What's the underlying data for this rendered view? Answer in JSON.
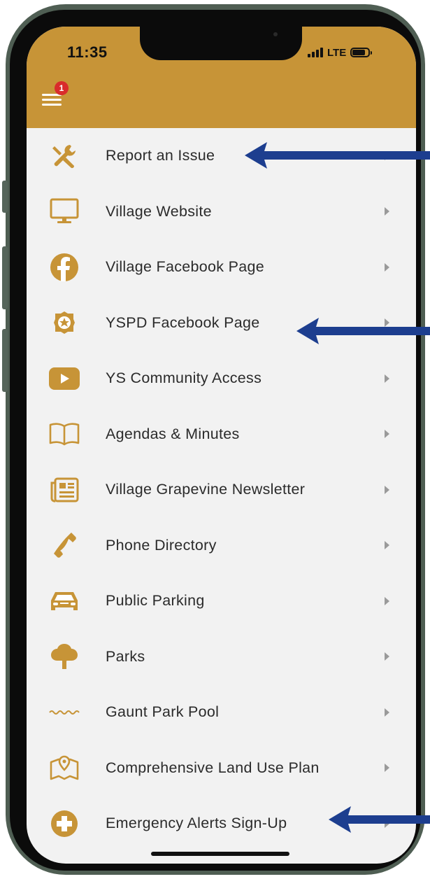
{
  "status_bar": {
    "time": "11:35",
    "network": "LTE"
  },
  "header": {
    "notification_count": "1"
  },
  "menu": {
    "items": [
      {
        "label": "Report an Issue",
        "icon": "tools-icon"
      },
      {
        "label": "Village Website",
        "icon": "monitor-icon"
      },
      {
        "label": "Village Facebook Page",
        "icon": "facebook-icon"
      },
      {
        "label": "YSPD Facebook Page",
        "icon": "police-badge-icon"
      },
      {
        "label": "YS Community Access",
        "icon": "youtube-icon"
      },
      {
        "label": "Agendas & Minutes",
        "icon": "book-icon"
      },
      {
        "label": "Village Grapevine Newsletter",
        "icon": "newspaper-icon"
      },
      {
        "label": "Phone Directory",
        "icon": "phone-icon"
      },
      {
        "label": "Public Parking",
        "icon": "car-icon"
      },
      {
        "label": "Parks",
        "icon": "tree-icon"
      },
      {
        "label": "Gaunt Park Pool",
        "icon": "water-icon"
      },
      {
        "label": "Comprehensive Land Use Plan",
        "icon": "map-pin-icon"
      },
      {
        "label": "Emergency Alerts Sign-Up",
        "icon": "plus-circle-icon"
      }
    ]
  },
  "colors": {
    "header": "#c79437",
    "icon": "#c79437",
    "arrow": "#1d3e8f",
    "badge": "#d92b2b"
  }
}
